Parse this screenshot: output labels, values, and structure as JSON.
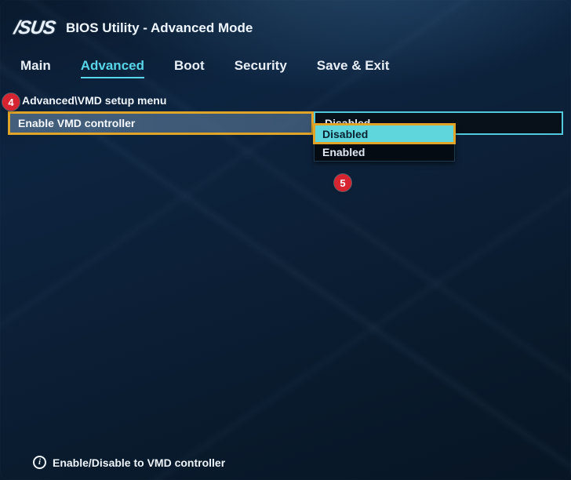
{
  "header": {
    "brand": "/SUS",
    "title": "BIOS Utility - Advanced Mode"
  },
  "tabs": [
    {
      "label": "Main",
      "active": false
    },
    {
      "label": "Advanced",
      "active": true
    },
    {
      "label": "Boot",
      "active": false
    },
    {
      "label": "Security",
      "active": false
    },
    {
      "label": "Save & Exit",
      "active": false
    }
  ],
  "breadcrumb": "Advanced\\VMD setup menu",
  "setting": {
    "label": "Enable VMD controller",
    "value": "Disabled"
  },
  "dropdown": {
    "options": [
      {
        "label": "Disabled",
        "selected": true
      },
      {
        "label": "Enabled",
        "selected": false
      }
    ]
  },
  "callouts": {
    "step4": "4",
    "step5": "5"
  },
  "footer": {
    "hint": "Enable/Disable to VMD controller"
  }
}
